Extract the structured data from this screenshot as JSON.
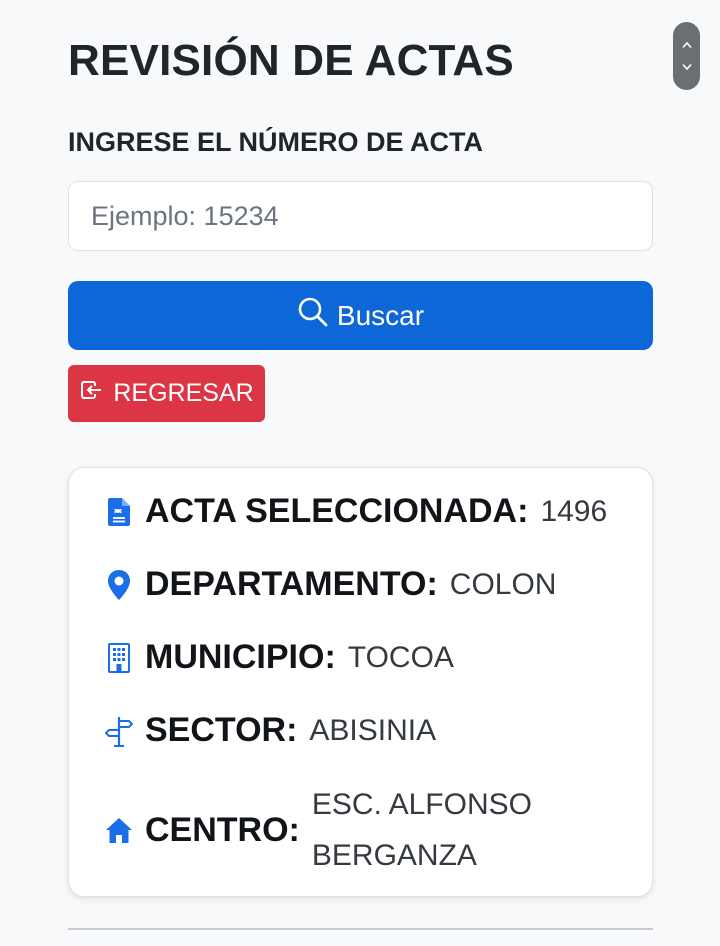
{
  "header": {
    "title": "REVISIÓN DE ACTAS"
  },
  "form": {
    "label": "INGRESE EL NÚMERO DE ACTA",
    "input_value": "",
    "placeholder": "Ejemplo: 15234",
    "search_label": "Buscar",
    "back_label": "REGRESAR"
  },
  "details": {
    "acta": {
      "label": "ACTA SELECCIONADA:",
      "value": "1496",
      "icon": "document-icon"
    },
    "departamento": {
      "label": "DEPARTAMENTO:",
      "value": "COLON",
      "icon": "location-pin-icon"
    },
    "municipio": {
      "label": "MUNICIPIO:",
      "value": "TOCOA",
      "icon": "building-icon"
    },
    "sector": {
      "label": "SECTOR:",
      "value": "ABISINIA",
      "icon": "signpost-icon"
    },
    "centro": {
      "label": "CENTRO:",
      "value": "ESC. ALFONSO BERGANZA",
      "icon": "home-icon"
    }
  },
  "colors": {
    "primary": "#0d67d9",
    "danger": "#dc3545",
    "icon_blue": "#1a6fe8",
    "background": "#f8f9fa"
  }
}
